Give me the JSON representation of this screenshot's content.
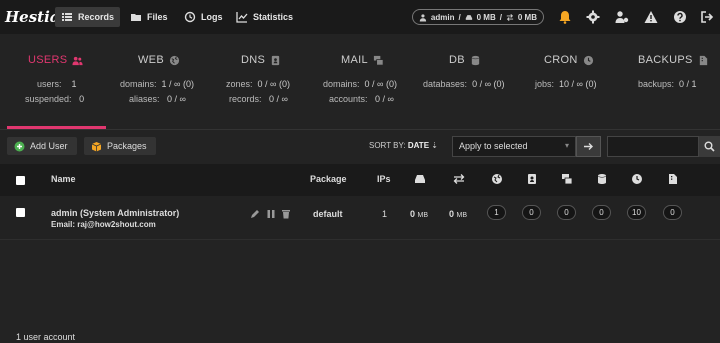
{
  "app": {
    "logo": "Hestia"
  },
  "nav": {
    "records": "Records",
    "files": "Files",
    "logs": "Logs",
    "statistics": "Statistics"
  },
  "usage": {
    "user": "admin",
    "disk": "0 MB",
    "bandwidth": "0 MB"
  },
  "stats": {
    "users": {
      "title": "USERS",
      "l1_label": "users:",
      "l1_value": "1",
      "l2_label": "suspended:",
      "l2_value": "0"
    },
    "web": {
      "title": "WEB",
      "l1_label": "domains:",
      "l1_value": "1 / ∞ (0)",
      "l2_label": "aliases:",
      "l2_value": "0 / ∞"
    },
    "dns": {
      "title": "DNS",
      "l1_label": "zones:",
      "l1_value": "0 / ∞ (0)",
      "l2_label": "records:",
      "l2_value": "0 / ∞"
    },
    "mail": {
      "title": "MAIL",
      "l1_label": "domains:",
      "l1_value": "0 / ∞ (0)",
      "l2_label": "accounts:",
      "l2_value": "0 / ∞"
    },
    "db": {
      "title": "DB",
      "l1_label": "databases:",
      "l1_value": "0 / ∞ (0)"
    },
    "cron": {
      "title": "CRON",
      "l1_label": "jobs:",
      "l1_value": "10 / ∞ (0)"
    },
    "backups": {
      "title": "BACKUPS",
      "l1_label": "backups:",
      "l1_value": "0 / 1"
    }
  },
  "toolbar": {
    "add_user": "Add User",
    "packages": "Packages",
    "sort_by": "SORT BY:",
    "sort_field": "DATE",
    "bulk_action": "Apply to selected"
  },
  "table": {
    "headers": {
      "name": "Name",
      "package": "Package",
      "ips": "IPs"
    },
    "rows": [
      {
        "username": "admin",
        "fullname": "(System Administrator)",
        "email": "Email: raj@how2shout.com",
        "package": "default",
        "ips": "1",
        "disk": "0",
        "bandwidth": "0",
        "unit": "MB",
        "web": "1",
        "dns": "0",
        "mail": "0",
        "db": "0",
        "cron": "10",
        "backups": "0"
      }
    ]
  },
  "footer": {
    "count": "1 user account"
  },
  "colors": {
    "accent": "#e0376f",
    "warning": "#f5a623",
    "add": "#4caf50"
  }
}
